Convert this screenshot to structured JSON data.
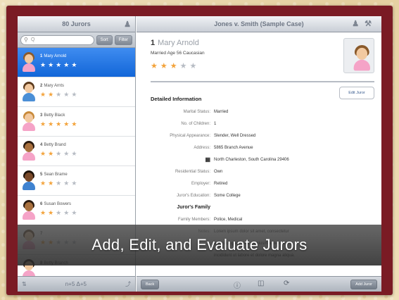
{
  "left_pane": {
    "title": "80 Jurors",
    "search_placeholder": "Q",
    "search_buttons": [
      "Sort",
      "Filter"
    ],
    "jurors": [
      {
        "num": "1",
        "name": "Mary Arnold",
        "stars": 5,
        "selected": true,
        "skin": "#f2c9a0",
        "hair": "#8a5a2b",
        "shirt": "#f5a3c7"
      },
      {
        "num": "2",
        "name": "Mary Arnts",
        "stars": 2,
        "selected": false,
        "skin": "#f2c9a0",
        "hair": "#5b3a1c",
        "shirt": "#4b8fd6"
      },
      {
        "num": "3",
        "name": "Betty Black",
        "stars": 5,
        "selected": false,
        "skin": "#f2c9a0",
        "hair": "#c88a3a",
        "shirt": "#f5a3c7"
      },
      {
        "num": "4",
        "name": "Betty Brand",
        "stars": 2,
        "selected": false,
        "skin": "#a9713f",
        "hair": "#2b1b10",
        "shirt": "#f5a3c7"
      },
      {
        "num": "5",
        "name": "Sean Brame",
        "stars": 2,
        "selected": false,
        "skin": "#7a4a2a",
        "hair": "#1e130a",
        "shirt": "#3f82d0"
      },
      {
        "num": "6",
        "name": "Susan Bowers",
        "stars": 2,
        "selected": false,
        "skin": "#a9713f",
        "hair": "#2b1b10",
        "shirt": "#f5a3c7"
      },
      {
        "num": "7",
        "name": "",
        "stars": 2,
        "selected": false,
        "skin": "#f2c9a0",
        "hair": "#5b3a1c",
        "shirt": "#f5a3c7"
      },
      {
        "num": "8",
        "name": "Betty Branch",
        "stars": 0,
        "selected": false,
        "skin": "#f2c9a0",
        "hair": "#2b1b10",
        "shirt": "#f5a3c7"
      }
    ],
    "bottom_left_icon": "sort-icon",
    "bottom_center": "n+5 Δ+5",
    "bottom_right_icon": "export-icon"
  },
  "right_pane": {
    "title": "Jones v. Smith (Sample Case)",
    "juror_number": "1",
    "juror_name": "Mary Arnold",
    "juror_summary": "Married Age 56 Caucasian",
    "juror_stars": 3,
    "edit_button": "Edit Juror",
    "section_title": "Detailed Information",
    "fields": [
      {
        "label": "Marital Status:",
        "value": "Married"
      },
      {
        "label": "No. of Children:",
        "value": "1"
      },
      {
        "label": "Physical Appearance:",
        "value": "Slender, Well Dressed"
      },
      {
        "label": "Address:",
        "value": "5865 Branch Avenue"
      },
      {
        "label": "map-icon",
        "value": "North Charleston, South Carolina 29406"
      },
      {
        "label": "Residential Status:",
        "value": "Own"
      },
      {
        "label": "Employer:",
        "value": "Retired"
      },
      {
        "label": "Juror's Education:",
        "value": "Some College"
      },
      {
        "label": "Juror's Family",
        "value": "",
        "heading": true
      },
      {
        "label": "Family Members:",
        "value": "Police, Medical"
      },
      {
        "label": "Notes:",
        "value": "Lorem ipsum dolor sit amet, consectetur"
      },
      {
        "label": "",
        "value": "adipisicing elit, sed do eiusmod tempor"
      },
      {
        "label": "",
        "value": "incididunt ut labore et dolore magna aliqua."
      }
    ],
    "bottom_left_button": "Back",
    "bottom_right_button": "Add Juror",
    "bottom_icons": [
      "info-icon",
      "trash-icon",
      "refresh-icon"
    ]
  },
  "caption": "Add, Edit, and Evaluate Jurors",
  "colors": {
    "frame": "#7a1b24",
    "selection": "#1266d8",
    "star_on": "#f3a33b",
    "star_off": "#b7bcc4"
  }
}
